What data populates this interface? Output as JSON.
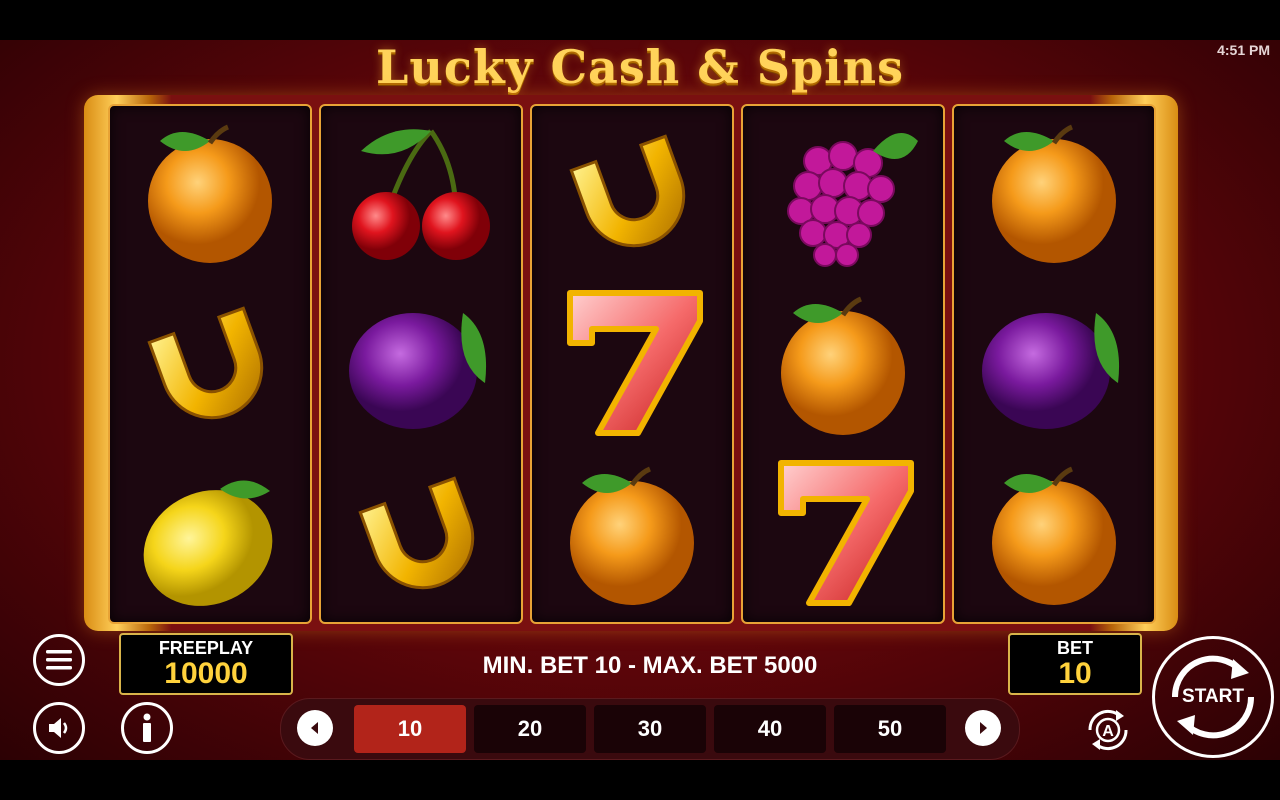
{
  "status_bar": {
    "time": "4:51 PM"
  },
  "game": {
    "title": "Lucky Cash & Spins"
  },
  "reels": [
    [
      "orange",
      "horseshoe",
      "lemon"
    ],
    [
      "cherry",
      "plum",
      "horseshoe"
    ],
    [
      "horseshoe",
      "seven",
      "orange"
    ],
    [
      "grapes",
      "orange",
      "seven"
    ],
    [
      "orange",
      "plum",
      "orange"
    ]
  ],
  "freeplay": {
    "label": "FREEPLAY",
    "value": "10000"
  },
  "bet": {
    "label": "BET",
    "value": "10"
  },
  "bet_limits": "MIN. BET 10 - MAX. BET 5000",
  "bet_options": [
    "10",
    "20",
    "30",
    "40",
    "50"
  ],
  "selected_bet": "10",
  "start_label": "START",
  "autoplay_label": "A",
  "colors": {
    "accent": "#ffd23c",
    "frame": "#e8a336",
    "selected": "#b2241a"
  },
  "icons": {
    "menu": "hamburger-icon",
    "sound": "speaker-icon",
    "info": "info-icon",
    "prev": "chevron-left-icon",
    "next": "chevron-right-icon",
    "auto": "autoplay-icon",
    "start": "spin-arrows-icon"
  }
}
